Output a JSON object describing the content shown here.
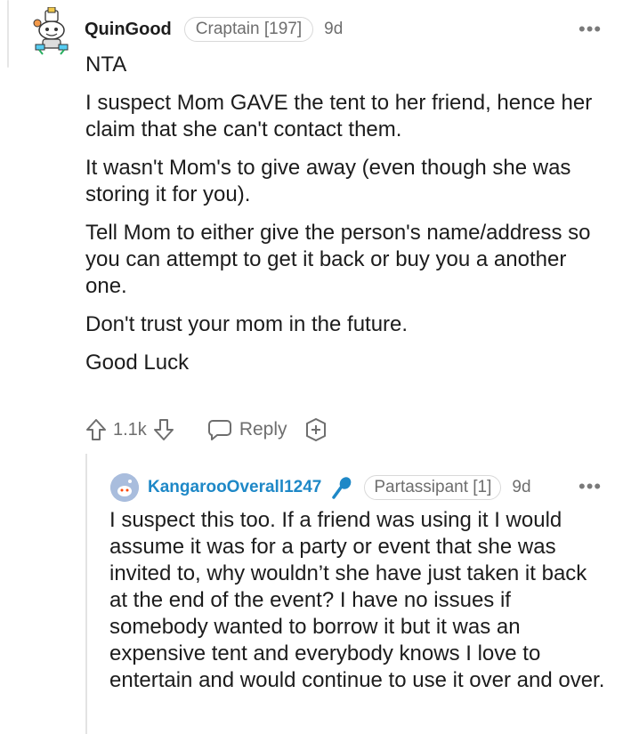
{
  "comment": {
    "author": "QuinGood",
    "flair": "Craptain [197]",
    "age": "9d",
    "more_label": "•••",
    "paragraphs": [
      "NTA",
      "I suspect Mom GAVE the tent to her friend, hence her claim that she can't contact them.",
      "It wasn't Mom's to give away (even though she was storing it for you).",
      "Tell Mom to either give the person's name/address so you can attempt to get it back or buy you a another one.",
      "Don't trust your mom in the future.",
      "Good Luck"
    ],
    "score": "1.1k",
    "reply_label": "Reply"
  },
  "reply": {
    "author": "KangarooOverall1247",
    "flair": "Partassipant [1]",
    "age": "9d",
    "more_label": "•••",
    "text": "I suspect this too. If a friend was using it I would assume it was for a party or event that she was invited to, why wouldn’t she have just taken it back at the end of the event? I have no issues if somebody wanted to borrow it but it was an expensive tent and everybody knows I love to entertain and would continue to use it over and over.",
    "author_color": "#1e88c7",
    "mic_color": "#1e88c7"
  }
}
